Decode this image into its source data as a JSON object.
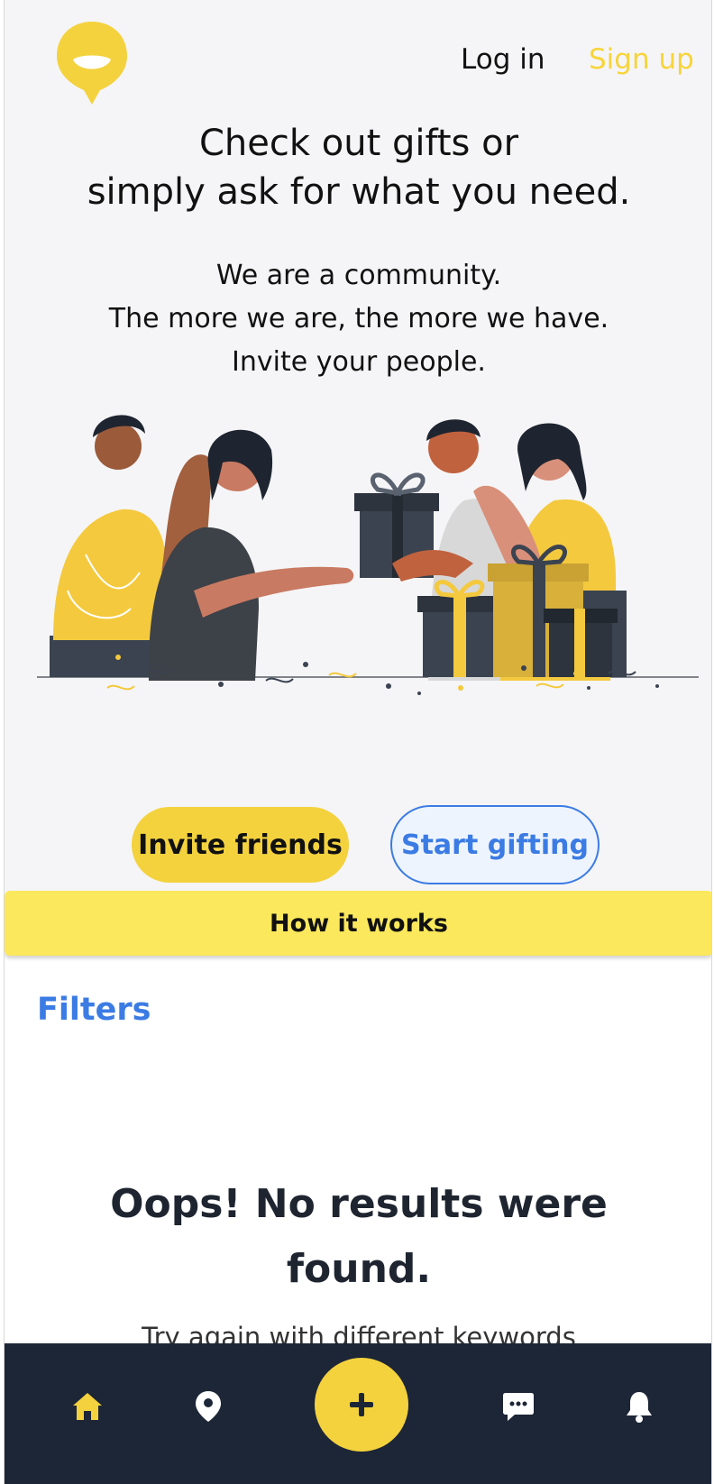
{
  "header": {
    "login_label": "Log in",
    "signup_label": "Sign up",
    "logo_icon": "speech-bubble-logo-icon"
  },
  "hero": {
    "headline_line1": "Check out gifts or",
    "headline_line2": "simply ask for what you need.",
    "sub_line1": "We are a community.",
    "sub_line2": "The more we are, the more we have.",
    "sub_line3": "Invite your people.",
    "illustration": "friends-exchanging-gifts-illustration"
  },
  "actions": {
    "invite_label": "Invite friends",
    "start_label": "Start gifting"
  },
  "how_it_works_label": "How it works",
  "filters_label": "Filters",
  "empty_state": {
    "title": "Oops! No results were found.",
    "hint": "Try again with different keywords"
  },
  "tabbar": {
    "items": [
      "home-icon",
      "map-pin-icon",
      "add-icon",
      "chat-icon",
      "bell-icon"
    ]
  },
  "colors": {
    "brand_yellow": "#f4d23e",
    "accent_blue": "#3b7be4",
    "tabbar_bg": "#1d2636",
    "hero_bg": "#f5f5f7"
  }
}
